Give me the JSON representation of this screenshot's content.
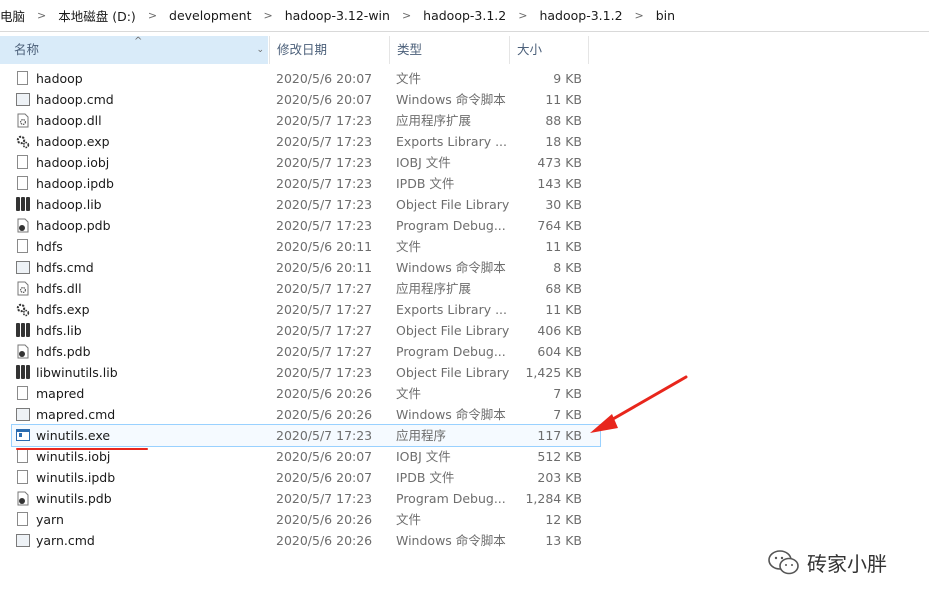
{
  "breadcrumb": [
    "电脑",
    "本地磁盘 (D:)",
    "development",
    "hadoop-3.12-win",
    "hadoop-3.1.2",
    "hadoop-3.1.2",
    "bin"
  ],
  "columns": {
    "name": "名称",
    "date": "修改日期",
    "type": "类型",
    "size": "大小"
  },
  "files": [
    {
      "name": "hadoop",
      "date": "2020/5/6 20:07",
      "type": "文件",
      "size": "9 KB",
      "icon": "file-icon"
    },
    {
      "name": "hadoop.cmd",
      "date": "2020/5/6 20:07",
      "type": "Windows 命令脚本",
      "size": "11 KB",
      "icon": "cmd-script-icon"
    },
    {
      "name": "hadoop.dll",
      "date": "2020/5/7 17:23",
      "type": "应用程序扩展",
      "size": "88 KB",
      "icon": "dll-icon"
    },
    {
      "name": "hadoop.exp",
      "date": "2020/5/7 17:23",
      "type": "Exports Library ...",
      "size": "18 KB",
      "icon": "exp-gear-icon"
    },
    {
      "name": "hadoop.iobj",
      "date": "2020/5/7 17:23",
      "type": "IOBJ 文件",
      "size": "473 KB",
      "icon": "file-icon"
    },
    {
      "name": "hadoop.ipdb",
      "date": "2020/5/7 17:23",
      "type": "IPDB 文件",
      "size": "143 KB",
      "icon": "file-icon"
    },
    {
      "name": "hadoop.lib",
      "date": "2020/5/7 17:23",
      "type": "Object File Library",
      "size": "30 KB",
      "icon": "lib-icon"
    },
    {
      "name": "hadoop.pdb",
      "date": "2020/5/7 17:23",
      "type": "Program Debug...",
      "size": "764 KB",
      "icon": "pdb-icon"
    },
    {
      "name": "hdfs",
      "date": "2020/5/6 20:11",
      "type": "文件",
      "size": "11 KB",
      "icon": "file-icon"
    },
    {
      "name": "hdfs.cmd",
      "date": "2020/5/6 20:11",
      "type": "Windows 命令脚本",
      "size": "8 KB",
      "icon": "cmd-script-icon"
    },
    {
      "name": "hdfs.dll",
      "date": "2020/5/7 17:27",
      "type": "应用程序扩展",
      "size": "68 KB",
      "icon": "dll-icon"
    },
    {
      "name": "hdfs.exp",
      "date": "2020/5/7 17:27",
      "type": "Exports Library ...",
      "size": "11 KB",
      "icon": "exp-gear-icon"
    },
    {
      "name": "hdfs.lib",
      "date": "2020/5/7 17:27",
      "type": "Object File Library",
      "size": "406 KB",
      "icon": "lib-icon"
    },
    {
      "name": "hdfs.pdb",
      "date": "2020/5/7 17:27",
      "type": "Program Debug...",
      "size": "604 KB",
      "icon": "pdb-icon"
    },
    {
      "name": "libwinutils.lib",
      "date": "2020/5/7 17:23",
      "type": "Object File Library",
      "size": "1,425 KB",
      "icon": "lib-icon"
    },
    {
      "name": "mapred",
      "date": "2020/5/6 20:26",
      "type": "文件",
      "size": "7 KB",
      "icon": "file-icon"
    },
    {
      "name": "mapred.cmd",
      "date": "2020/5/6 20:26",
      "type": "Windows 命令脚本",
      "size": "7 KB",
      "icon": "cmd-script-icon"
    },
    {
      "name": "winutils.exe",
      "date": "2020/5/7 17:23",
      "type": "应用程序",
      "size": "117 KB",
      "icon": "exe-icon",
      "selected": true
    },
    {
      "name": "winutils.iobj",
      "date": "2020/5/6 20:07",
      "type": "IOBJ 文件",
      "size": "512 KB",
      "icon": "file-icon"
    },
    {
      "name": "winutils.ipdb",
      "date": "2020/5/6 20:07",
      "type": "IPDB 文件",
      "size": "203 KB",
      "icon": "file-icon"
    },
    {
      "name": "winutils.pdb",
      "date": "2020/5/7 17:23",
      "type": "Program Debug...",
      "size": "1,284 KB",
      "icon": "pdb-icon"
    },
    {
      "name": "yarn",
      "date": "2020/5/6 20:26",
      "type": "文件",
      "size": "12 KB",
      "icon": "file-icon"
    },
    {
      "name": "yarn.cmd",
      "date": "2020/5/6 20:26",
      "type": "Windows 命令脚本",
      "size": "13 KB",
      "icon": "cmd-script-icon"
    }
  ],
  "watermark": "砖家小胖",
  "colors": {
    "annotation_red": "#e8261c",
    "selection_border": "#99d1ff",
    "header_active": "#d9ebf9"
  }
}
